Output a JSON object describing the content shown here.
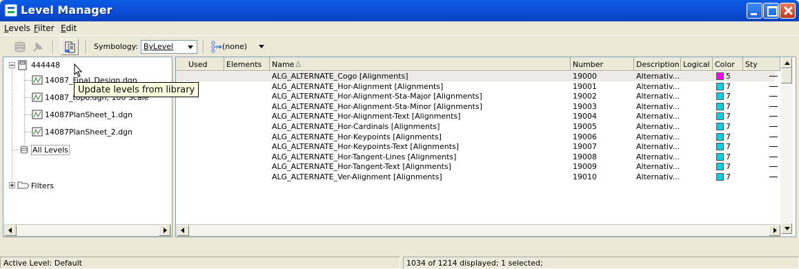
{
  "window": {
    "title": "Level Manager"
  },
  "menu": [
    {
      "label": "Levels",
      "u": "L",
      "rest": "evels"
    },
    {
      "label": "Filter",
      "u": "F",
      "rest": "ilter"
    },
    {
      "label": "Edit",
      "u": "E",
      "rest": "dit"
    }
  ],
  "toolbar": {
    "symbology_label": "Symbology:",
    "symbology_value": "ByLevel",
    "filter_value": "(none)"
  },
  "tooltip": "Update levels from library",
  "tree": {
    "root_label": "444448",
    "children": [
      "14087_Final_Design.dgn",
      "14087_topo.dgn, 100 Scale",
      "14087PlanSheet_1.dgn",
      "14087PlanSheet_2.dgn"
    ],
    "all_levels": "All Levels",
    "filters": "Filters"
  },
  "columns": {
    "used": "Used",
    "elements": "Elements",
    "name": "Name",
    "sort_indicator": "∆",
    "number": "Number",
    "description": "Description",
    "logical": "Logical",
    "color": "Color",
    "style": "Sty"
  },
  "rows": [
    {
      "name": "ALG_ALTERNATE_Cogo [Alignments]",
      "number": "19000",
      "description": "Alternativ...",
      "color": "5",
      "color_hex": "#ff00ff",
      "selected": true
    },
    {
      "name": "ALG_ALTERNATE_Hor-Alignment [Alignments]",
      "number": "19001",
      "description": "Alternativ...",
      "color": "7",
      "color_hex": "#00d2e6"
    },
    {
      "name": "ALG_ALTERNATE_Hor-Alignment-Sta-Major [Alignments]",
      "number": "19002",
      "description": "Alternativ...",
      "color": "7",
      "color_hex": "#00d2e6"
    },
    {
      "name": "ALG_ALTERNATE_Hor-Alignment-Sta-Minor [Alignments]",
      "number": "19003",
      "description": "Alternativ...",
      "color": "7",
      "color_hex": "#00d2e6"
    },
    {
      "name": "ALG_ALTERNATE_Hor-Alignment-Text [Alignments]",
      "number": "19004",
      "description": "Alternativ...",
      "color": "7",
      "color_hex": "#00d2e6"
    },
    {
      "name": "ALG_ALTERNATE_Hor-Cardinals [Alignments]",
      "number": "19005",
      "description": "Alternativ...",
      "color": "7",
      "color_hex": "#00d2e6"
    },
    {
      "name": "ALG_ALTERNATE_Hor-Keypoints [Alignments]",
      "number": "19006",
      "description": "Alternativ...",
      "color": "7",
      "color_hex": "#00d2e6"
    },
    {
      "name": "ALG_ALTERNATE_Hor-Keypoints-Text [Alignments]",
      "number": "19007",
      "description": "Alternativ...",
      "color": "7",
      "color_hex": "#00d2e6"
    },
    {
      "name": "ALG_ALTERNATE_Hor-Tangent-Lines [Alignments]",
      "number": "19008",
      "description": "Alternativ...",
      "color": "7",
      "color_hex": "#00d2e6"
    },
    {
      "name": "ALG_ALTERNATE_Hor-Tangent-Text [Alignments]",
      "number": "19009",
      "description": "Alternativ...",
      "color": "7",
      "color_hex": "#00d2e6"
    },
    {
      "name": "ALG_ALTERNATE_Ver-Alignment [Alignments]",
      "number": "19010",
      "description": "Alternativ...",
      "color": "7",
      "color_hex": "#00d2e6"
    }
  ],
  "status": {
    "active_level": "Active Level: Default",
    "displayed": "1034 of 1214 displayed; 1 selected;"
  }
}
